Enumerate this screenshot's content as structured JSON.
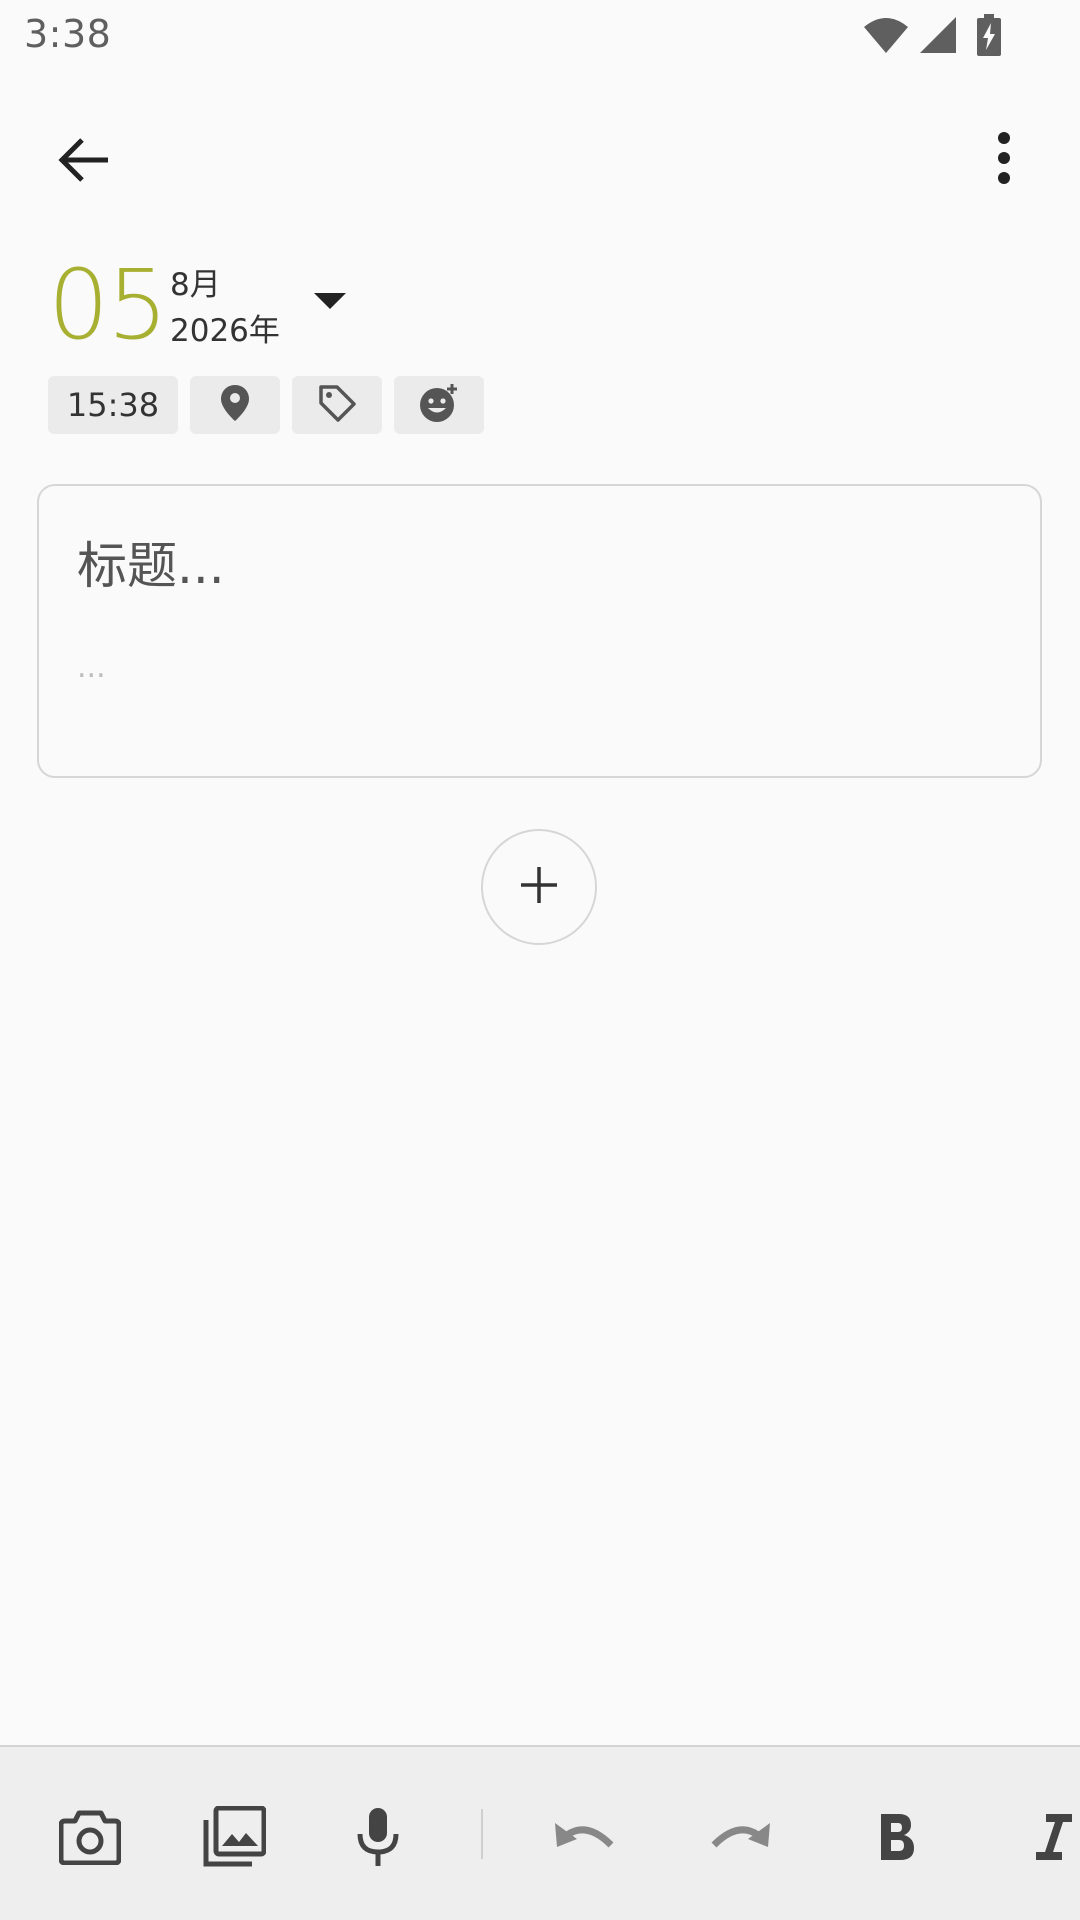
{
  "status_bar": {
    "time": "3:38",
    "icons": [
      "wifi-icon",
      "cell-signal-icon",
      "battery-charging-icon"
    ]
  },
  "app_bar": {
    "back_icon": "arrow-back-icon",
    "menu_icon": "more-vert-icon"
  },
  "date": {
    "day": "05",
    "month": "8月",
    "year": "2026年",
    "day_color": "#a8b032"
  },
  "chips": {
    "time": "15:38",
    "location_icon": "location-pin-icon",
    "tag_icon": "tag-icon",
    "mood_icon": "add-emoji-icon"
  },
  "note": {
    "title_placeholder": "标题...",
    "body_placeholder": "..."
  },
  "add_button_icon": "plus-icon",
  "toolbar": {
    "items": [
      "camera-icon",
      "gallery-icon",
      "microphone-icon",
      "undo-icon",
      "redo-icon",
      "bold-icon",
      "italic-icon"
    ]
  }
}
